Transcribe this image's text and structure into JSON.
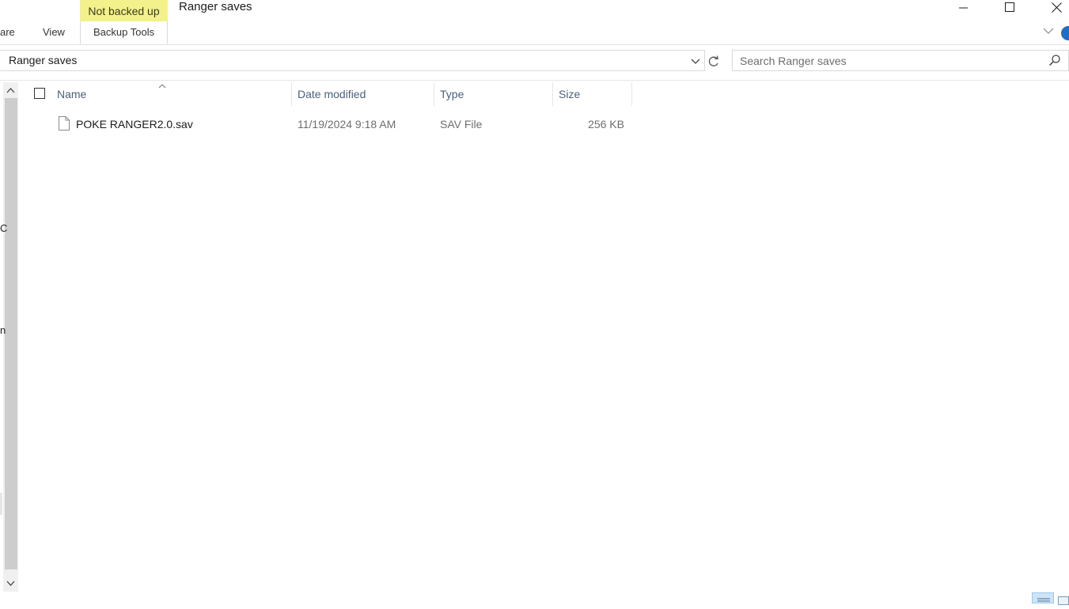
{
  "window": {
    "title": "Ranger saves",
    "context_tab_label": "Not backed up"
  },
  "ribbon": {
    "tabs": [
      {
        "label": "are"
      },
      {
        "label": "View"
      },
      {
        "label": "Backup Tools"
      }
    ]
  },
  "address_bar": {
    "path": "Ranger saves"
  },
  "search": {
    "placeholder": "Search Ranger saves"
  },
  "left_edge_marks": [
    "C",
    "n"
  ],
  "file_list": {
    "columns": [
      {
        "label": "Name"
      },
      {
        "label": "Date modified"
      },
      {
        "label": "Type"
      },
      {
        "label": "Size"
      }
    ],
    "rows": [
      {
        "name": "POKE RANGER2.0.sav",
        "date_modified": "11/19/2024 9:18 AM",
        "type": "SAV File",
        "size": "256 KB"
      }
    ]
  },
  "colors": {
    "context_tab": "#f3f18c",
    "header_text": "#4c607a",
    "accent": "#1a6fc4"
  }
}
